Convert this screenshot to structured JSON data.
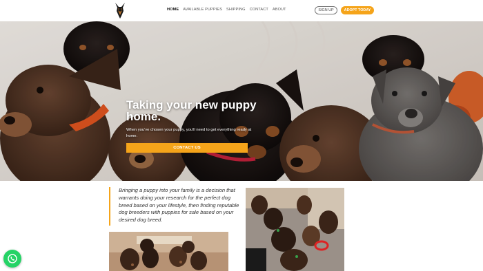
{
  "header": {
    "nav": [
      {
        "label": "HOME",
        "active": true
      },
      {
        "label": "AVAILABLE PUPPIES",
        "active": false
      },
      {
        "label": "SHIPPING",
        "active": false
      },
      {
        "label": "CONTACT",
        "active": false
      },
      {
        "label": "ABOUT",
        "active": false
      }
    ],
    "signup_label": "SIGN UP",
    "adopt_label": "ADOPT TODAY"
  },
  "hero": {
    "title": "Taking your new puppy home.",
    "subtitle": "When you've chosen your puppy, you'll need to get everything ready at home.",
    "cta_label": "CONTACT US"
  },
  "content": {
    "quote": "Bringing a puppy into your family is a decision that warrants doing your research for the perfect dog breed based on your lifestyle, then finding reputable dog breeders with puppies for sale based on your desired dog breed."
  },
  "colors": {
    "accent": "#f5a41a",
    "whatsapp": "#25d366"
  },
  "icons": {
    "logo": "doberman-logo-icon",
    "chat": "whatsapp-icon"
  }
}
